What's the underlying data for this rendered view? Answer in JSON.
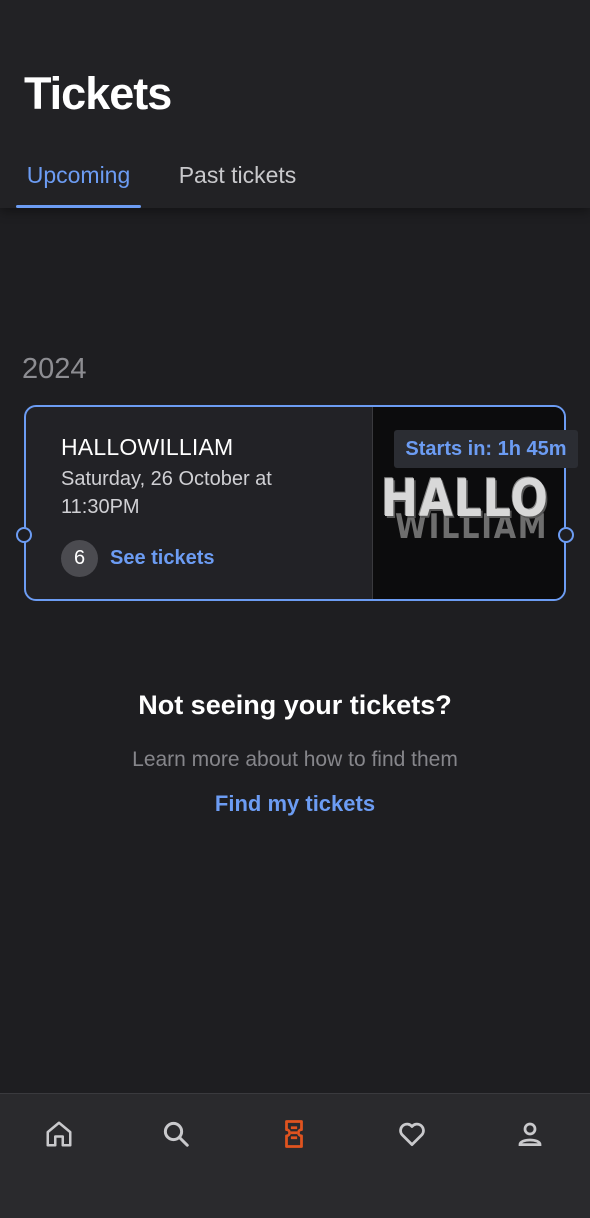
{
  "header": {
    "title": "Tickets",
    "tabs": [
      {
        "label": "Upcoming",
        "active": true
      },
      {
        "label": "Past tickets",
        "active": false
      }
    ]
  },
  "tickets_section": {
    "year": "2024",
    "events": [
      {
        "name": "HALLOWILLIAM",
        "date": "Saturday, 26 October at 11:30PM",
        "ticket_count": "6",
        "see_tickets_label": "See tickets",
        "countdown": "Starts in: 1h 45m",
        "image_title": "HALLO",
        "image_subtitle": "WILLIAM"
      }
    ]
  },
  "help": {
    "title": "Not seeing your tickets?",
    "subtitle": "Learn more about how to find them",
    "link": "Find my tickets"
  },
  "bottom_nav": {
    "items": [
      {
        "icon": "home-icon",
        "active": false
      },
      {
        "icon": "search-icon",
        "active": false
      },
      {
        "icon": "ticket-icon",
        "active": true
      },
      {
        "icon": "heart-icon",
        "active": false
      },
      {
        "icon": "profile-icon",
        "active": false
      }
    ]
  },
  "colors": {
    "background": "#1e1e21",
    "accent": "#6c9cf3",
    "active_nav": "#e0531f",
    "inactive_nav": "#c9c9cc"
  }
}
